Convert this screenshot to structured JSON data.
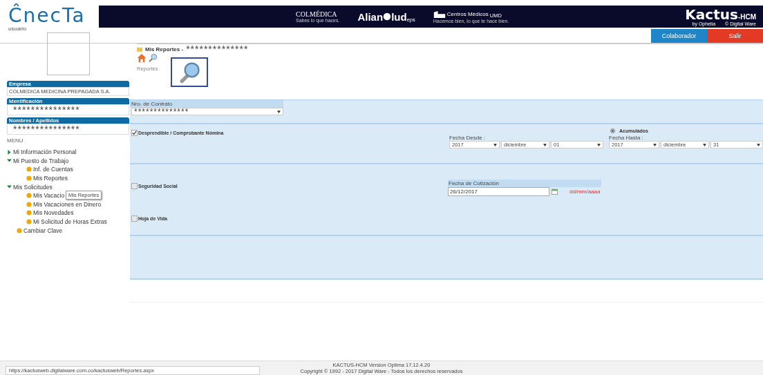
{
  "header": {
    "logo": "ĈnecTa",
    "user_label": "usuario",
    "brands": [
      {
        "kind": "colmedica",
        "name": "COLMÉDICA",
        "tagline": "Sabes lo que haces."
      },
      {
        "kind": "aliansalud",
        "name": "Alian",
        "name2": "lud",
        "sub": "eps"
      },
      {
        "kind": "centros",
        "name": "Centros Médicos",
        "sub": "UMD",
        "tagline": "Hacemos bien, lo que te hace bien."
      }
    ],
    "product": {
      "name": "Kactus",
      "suffix": "-HCM",
      "by": "by Ophelia",
      "maker": "© Digital Ware"
    },
    "buttons": [
      {
        "label": "Colaborador",
        "kind": "primary"
      },
      {
        "label": "Salir",
        "kind": "danger"
      }
    ]
  },
  "sidebar": {
    "fields": [
      {
        "label": "Empresa",
        "value": "COLMEDICA MEDICINA PREPAGADA S.A.",
        "masked": false
      },
      {
        "label": "Identificación",
        "value": "***************",
        "masked": true
      },
      {
        "label": "Nombres / Apellidos",
        "value": "***************",
        "masked": true
      }
    ],
    "menu_title": "MENU",
    "menu": [
      {
        "label": "Mi Información Personal",
        "expanded": false
      },
      {
        "label": "Mi Puesto de Trabajo",
        "expanded": true,
        "children": [
          {
            "label": "Inf. de Cuentas"
          },
          {
            "label": "Mis Reportes"
          }
        ]
      },
      {
        "label": "Mis Solicitudes",
        "expanded": true,
        "children": [
          {
            "label": "Mis Vacacio"
          },
          {
            "label": "Mis Vacaciones en Dinero"
          },
          {
            "label": "Mis Novedades"
          },
          {
            "label": "Mi Solicitud de Horas Extras"
          }
        ]
      },
      {
        "label": "Cambiar Clave"
      }
    ],
    "tooltip": "Mis Reportes"
  },
  "page": {
    "title": "Mis Reportes -",
    "masked_name": "**************",
    "toolbar_label": "Reportes"
  },
  "form": {
    "contract": {
      "label": "Nro. de Contrato",
      "value": "**************"
    },
    "payslip": {
      "label": "Desprendible / Comprobante Nómina",
      "checked": true,
      "radio_label": "Acumulados",
      "radio_selected": true,
      "from": {
        "label": "Fecha Desde :",
        "year": "2017",
        "month": "diciembre",
        "day": "01"
      },
      "to": {
        "label": "Fecha Hasta :",
        "year": "2017",
        "month": "diciembre",
        "day": "31"
      }
    },
    "social": {
      "label": "Seguridad Social",
      "checked": false,
      "date_label": "Fecha de Cotización",
      "date_value": "26/12/2017",
      "format": "dd/mm/aaaa"
    },
    "cv": {
      "label": "Hoja de Vida",
      "checked": false
    }
  },
  "footer": {
    "url": "https://kactusweb.digitalware.com.co/kactusweb/Reportes.aspx",
    "version": "KACTUS-HCM Version Optima 17.12.4.20",
    "copyright": "Copyright © 1992 - 2017 Digital Ware - Todos los derechos reservados"
  }
}
